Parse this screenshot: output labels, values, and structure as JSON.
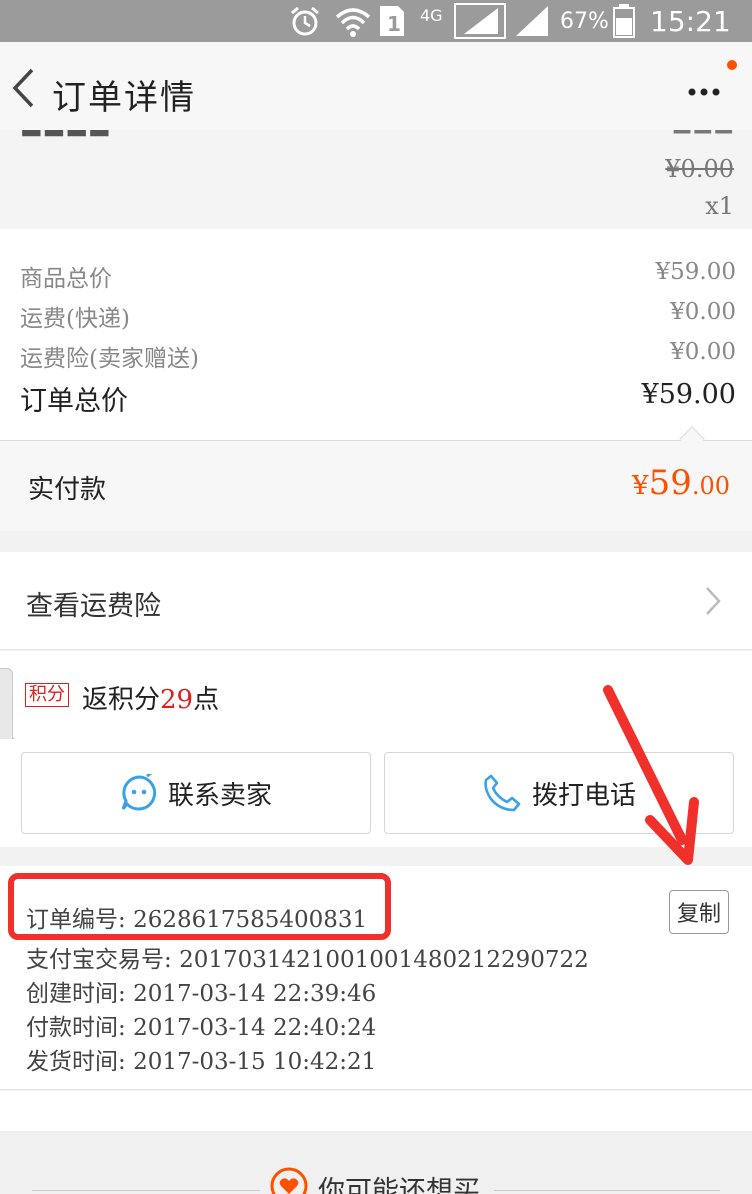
{
  "status_bar": {
    "network": "4G",
    "sim": "1",
    "battery_percent": "67%",
    "battery_level": 0.67,
    "time": "15:21",
    "icons": [
      "alarm-icon",
      "wifi-icon",
      "sim-icon",
      "signal-icon",
      "battery-icon"
    ]
  },
  "header": {
    "title": "订单详情",
    "back_icon": "back-chevron-icon",
    "more_icon": "more-dots-icon"
  },
  "item": {
    "original_price": "¥0.00",
    "quantity": "x1"
  },
  "summary": {
    "rows": [
      {
        "label": "商品总价",
        "value": "¥59.00"
      },
      {
        "label": "运费(快递)",
        "value": "¥0.00"
      },
      {
        "label": "运费险(卖家赠送)",
        "value": "¥0.00"
      }
    ],
    "total_label": "订单总价",
    "total_value": "¥59.00"
  },
  "paid": {
    "label": "实付款",
    "currency": "¥",
    "amount_int": "59",
    "amount_dec": ".00",
    "color": "#ff5000"
  },
  "insurance": {
    "label": "查看运费险"
  },
  "points": {
    "badge": "积分",
    "prefix": "返积分",
    "amount": "29",
    "suffix": "点"
  },
  "actions": {
    "contact_seller": "联系卖家",
    "call_phone": "拨打电话"
  },
  "order_info": {
    "order_no_label": "订单编号: ",
    "order_no": "2628617585400831",
    "copy_label": "复制",
    "alipay_label": "支付宝交易号: ",
    "alipay_no": "2017031421001001480212290722",
    "created_label": "创建时间: ",
    "created": "2017-03-14 22:39:46",
    "paid_label": "付款时间: ",
    "paid_time": "2017-03-14 22:40:24",
    "shipped_label": "发货时间: ",
    "shipped": "2017-03-15 10:42:21"
  },
  "recommend": {
    "title": "你可能还想买",
    "icon": "heart-icon"
  },
  "colors": {
    "accent": "#ff5000",
    "annotation_red": "#f0302a",
    "link_blue": "#3aa0e8"
  }
}
